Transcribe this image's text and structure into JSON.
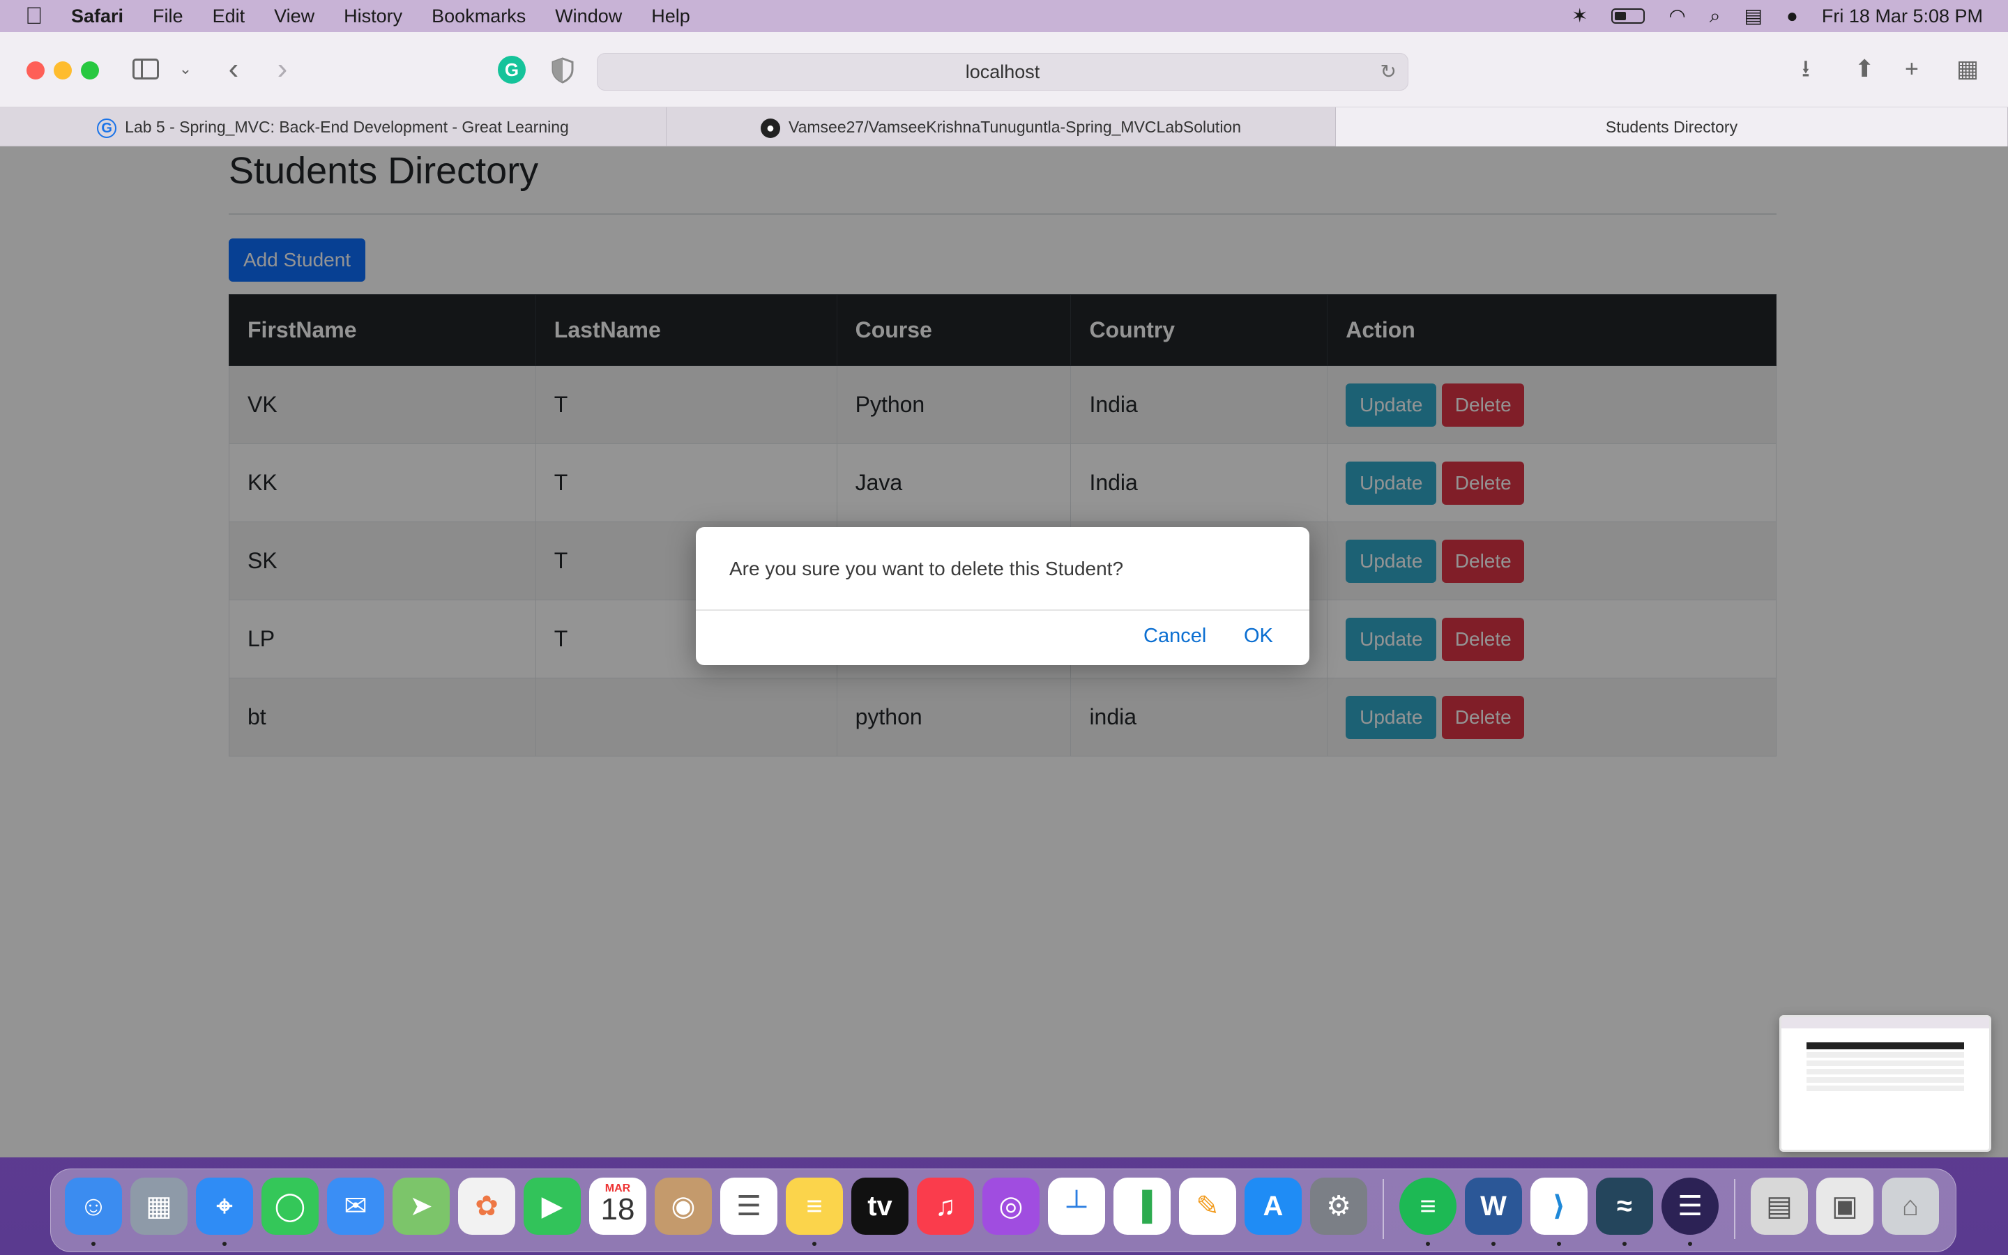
{
  "menubar": {
    "app_name": "Safari",
    "items": [
      "File",
      "Edit",
      "View",
      "History",
      "Bookmarks",
      "Window",
      "Help"
    ],
    "clock": "Fri 18 Mar  5:08 PM"
  },
  "browser": {
    "url": "localhost",
    "tabs": [
      {
        "label": "Lab 5 - Spring_MVC: Back-End Development - Great Learning",
        "active": false
      },
      {
        "label": "Vamsee27/VamseeKrishnaTunuguntla-Spring_MVCLabSolution",
        "active": false
      },
      {
        "label": "Students Directory",
        "active": true
      }
    ]
  },
  "page": {
    "title": "Students Directory",
    "add_button": "Add Student",
    "columns": [
      "FirstName",
      "LastName",
      "Course",
      "Country",
      "Action"
    ],
    "rows": [
      {
        "first": "VK",
        "last": "T",
        "course": "Python",
        "country": "India"
      },
      {
        "first": "KK",
        "last": "T",
        "course": "Java",
        "country": "India"
      },
      {
        "first": "SK",
        "last": "T",
        "course": "",
        "country": ""
      },
      {
        "first": "LP",
        "last": "T",
        "course": "",
        "country": ""
      },
      {
        "first": "bt",
        "last": "",
        "course": "python",
        "country": "india"
      }
    ],
    "update_label": "Update",
    "delete_label": "Delete"
  },
  "dialog": {
    "message": "Are you sure you want to delete this Student?",
    "cancel_label": "Cancel",
    "ok_label": "OK"
  },
  "dock": {
    "calendar_month": "MAR",
    "calendar_day": "18",
    "apps": [
      "finder-icon",
      "launchpad-icon",
      "safari-icon",
      "messages-icon",
      "mail-icon",
      "maps-icon",
      "photos-icon",
      "facetime-icon",
      "calendar-icon",
      "contacts-icon",
      "reminders-icon",
      "notes-icon",
      "appletv-icon",
      "music-icon",
      "podcasts-icon",
      "keynote-icon",
      "numbers-icon",
      "pages-icon",
      "appstore-icon",
      "system-preferences-icon",
      "spotify-icon",
      "word-icon",
      "vscode-icon",
      "mysql-workbench-icon",
      "eclipse-icon",
      "preview-icon",
      "screenshot-icon",
      "trash-icon"
    ]
  },
  "colors": {
    "primary": "#0d6efd",
    "info": "#0dcaf0",
    "danger": "#dc3545",
    "table_header": "#212529",
    "link_blue": "#0a6ed1"
  }
}
